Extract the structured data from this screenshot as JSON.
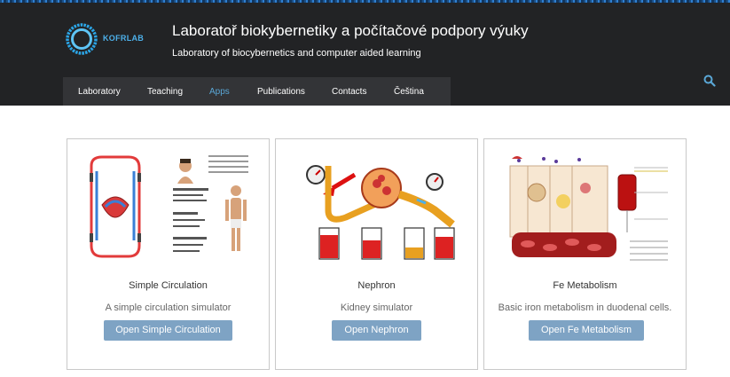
{
  "header": {
    "logo_text": "KOFRLAB",
    "title": "Laboratoř biokybernetiky a počítačové podpory výuky",
    "subtitle": "Laboratory of biocybernetics and computer aided learning",
    "search_icon": "search-icon"
  },
  "nav": {
    "active": "Apps",
    "items": [
      {
        "label": "Laboratory"
      },
      {
        "label": "Teaching"
      },
      {
        "label": "Apps"
      },
      {
        "label": "Publications"
      },
      {
        "label": "Contacts"
      },
      {
        "label": "Čeština"
      }
    ]
  },
  "cards": [
    {
      "title": "Simple Circulation",
      "description": "A simple circulation simulator",
      "button": "Open Simple Circulation"
    },
    {
      "title": "Nephron",
      "description": "Kidney simulator",
      "button": "Open Nephron"
    },
    {
      "title": "Fe Metabolism",
      "description": "Basic iron metabolism in duodenal cells.",
      "button": "Open Fe Metabolism"
    }
  ],
  "colors": {
    "header_bg": "#222325",
    "nav_bg": "#333437",
    "accent": "#5aa7d6",
    "button_bg": "#7ea3c4"
  }
}
